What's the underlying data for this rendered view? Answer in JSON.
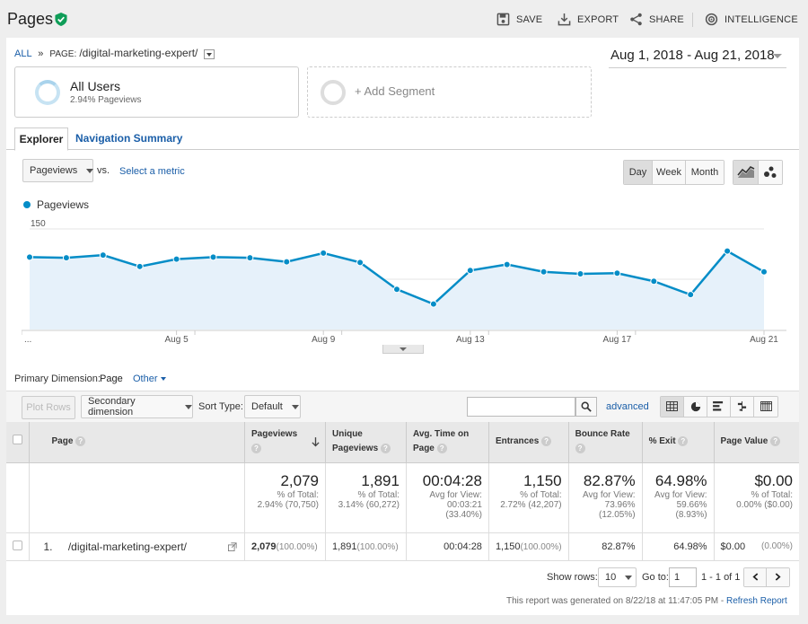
{
  "header": {
    "title": "Pages",
    "buttons": {
      "save": "SAVE",
      "export": "EXPORT",
      "share": "SHARE",
      "intelligence": "INTELLIGENCE"
    }
  },
  "breadcrumb": {
    "all": "ALL",
    "sep": "»",
    "page_prefix": "PAGE:",
    "page": "/digital-marketing-expert/"
  },
  "date_range": "Aug 1, 2018 - Aug 21, 2018",
  "segments": {
    "active_name": "All Users",
    "active_sub": "2.94% Pageviews",
    "add": "+ Add Segment"
  },
  "tabs": {
    "explorer": "Explorer",
    "navigation": "Navigation Summary"
  },
  "metric_controls": {
    "metric": "Pageviews",
    "vs": "vs.",
    "select_metric": "Select a metric",
    "day": "Day",
    "week": "Week",
    "month": "Month"
  },
  "legend": {
    "pageviews": "Pageviews"
  },
  "chart_data": {
    "type": "area",
    "series": [
      {
        "name": "Pageviews",
        "color": "#058dc7"
      }
    ],
    "x": [
      "Aug 1",
      "Aug 2",
      "Aug 3",
      "Aug 4",
      "Aug 5",
      "Aug 6",
      "Aug 7",
      "Aug 8",
      "Aug 9",
      "Aug 10",
      "Aug 11",
      "Aug 12",
      "Aug 13",
      "Aug 14",
      "Aug 15",
      "Aug 16",
      "Aug 17",
      "Aug 18",
      "Aug 19",
      "Aug 20",
      "Aug 21"
    ],
    "values": [
      108,
      107,
      111,
      94,
      105,
      108,
      107,
      101,
      114,
      100,
      60,
      38,
      88,
      97,
      86,
      83,
      84,
      72,
      52,
      117,
      86
    ],
    "ylim": [
      0,
      150
    ],
    "y_ticks": [
      "150",
      "75"
    ],
    "x_tick_labels": [
      "...",
      "Aug 5",
      "Aug 9",
      "Aug 13",
      "Aug 17",
      "Aug 21"
    ],
    "grid": true
  },
  "dimension": {
    "label": "Primary Dimension:",
    "page": "Page",
    "other": "Other"
  },
  "table_controls": {
    "plot_rows": "Plot Rows",
    "secondary": "Secondary dimension",
    "sort_type_label": "Sort Type:",
    "sort_type": "Default",
    "advanced": "advanced"
  },
  "table": {
    "headers": {
      "page": "Page",
      "pageviews": "Pageviews",
      "unique": "Unique Pageviews",
      "avg_time": "Avg. Time on Page",
      "entrances": "Entrances",
      "bounce": "Bounce Rate",
      "exit": "% Exit",
      "value": "Page Value"
    },
    "totals": {
      "pageviews": "2,079",
      "pageviews_sub1": "% of Total:",
      "pageviews_sub2": "2.94% (70,750)",
      "unique": "1,891",
      "unique_sub1": "% of Total:",
      "unique_sub2": "3.14% (60,272)",
      "avg_time": "00:04:28",
      "avg_time_sub1": "Avg for View:",
      "avg_time_sub2": "00:03:21",
      "avg_time_sub3": "(33.40%)",
      "entrances": "1,150",
      "entrances_sub1": "% of Total:",
      "entrances_sub2": "2.72% (42,207)",
      "bounce": "82.87%",
      "bounce_sub1": "Avg for View:",
      "bounce_sub2": "73.96%",
      "bounce_sub3": "(12.05%)",
      "exit": "64.98%",
      "exit_sub1": "Avg for View:",
      "exit_sub2": "59.66%",
      "exit_sub3": "(8.93%)",
      "value": "$0.00",
      "value_sub1": "% of Total:",
      "value_sub2": "0.00% ($0.00)"
    },
    "row": {
      "index": "1.",
      "page": "/digital-marketing-expert/",
      "pageviews": "2,079",
      "pageviews_pct": "(100.00%)",
      "unique": "1,891",
      "unique_pct": "(100.00%)",
      "avg_time": "00:04:28",
      "entrances": "1,150",
      "entrances_pct": "(100.00%)",
      "bounce": "82.87%",
      "exit": "64.98%",
      "value": "$0.00",
      "value_pct": "(0.00%)"
    }
  },
  "pagination": {
    "show_rows_label": "Show rows:",
    "show_rows": "10",
    "goto_label": "Go to:",
    "goto": "1",
    "range": "1 - 1 of 1"
  },
  "footer": {
    "generated": "This report was generated on 8/22/18 at 11:47:05 PM -",
    "refresh": "Refresh Report"
  }
}
